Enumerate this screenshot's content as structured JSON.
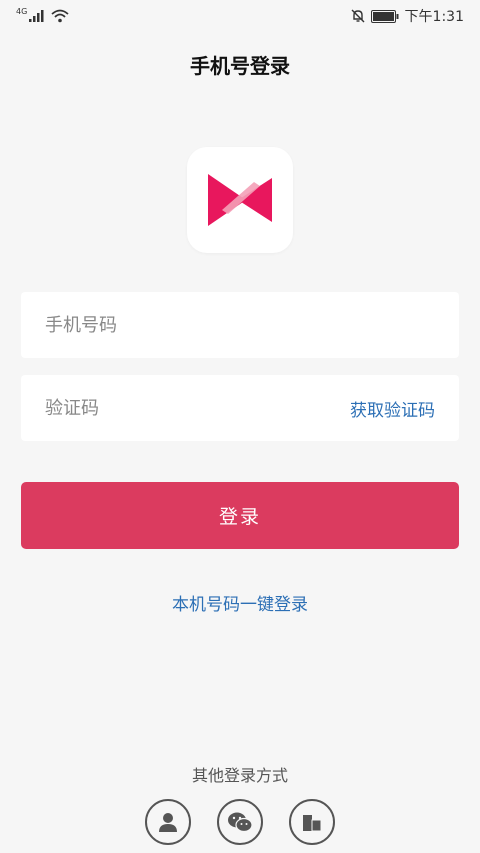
{
  "status_bar": {
    "network": "4G",
    "time": "下午1:31",
    "icons": [
      "signal-icon",
      "wifi-icon",
      "bell-muted-icon",
      "battery-icon"
    ]
  },
  "header": {
    "title": "手机号登录"
  },
  "logo": {
    "icon": "app-logo-icon",
    "colors": {
      "primary": "#e8175d",
      "secondary": "#f4a0b7"
    }
  },
  "form": {
    "phone": {
      "placeholder": "手机号码",
      "value": ""
    },
    "code": {
      "placeholder": "验证码",
      "value": "",
      "get_code_label": "获取验证码"
    },
    "login_label": "登录",
    "onekey_label": "本机号码一键登录"
  },
  "other_login": {
    "title": "其他登录方式",
    "methods": [
      {
        "icon": "user-icon"
      },
      {
        "icon": "wechat-icon"
      },
      {
        "icon": "building-icon"
      }
    ]
  },
  "colors": {
    "accent": "#db3b5f",
    "link": "#2c6fb5",
    "background": "#f6f6f6"
  }
}
